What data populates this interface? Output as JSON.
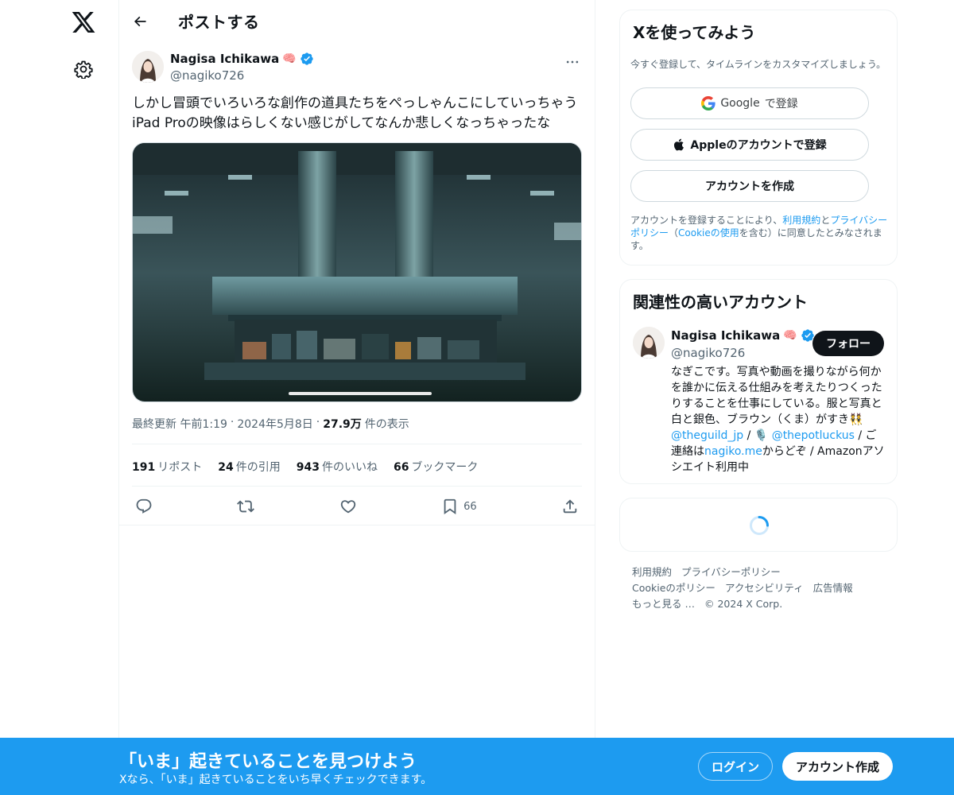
{
  "nav": {
    "logo_icon": "x-logo-icon",
    "settings_icon": "gear-icon"
  },
  "header": {
    "title": "ポストする",
    "back_icon": "arrow-left-icon"
  },
  "post": {
    "author_name": "Nagisa Ichikawa",
    "author_emoji": "🧠",
    "verified": true,
    "handle": "@nagiko726",
    "text": "しかし冒頭でいろいろな創作の道具たちをぺっしゃんこにしていっちゃう\niPad Proの映像はらしくない感じがしてなんか悲しくなっちゃったな",
    "meta_prefix": "最終更新 午前1:19",
    "meta_date": "2024年5月8日",
    "views_value": "27.9万",
    "views_label": "件の表示",
    "stats": {
      "reposts_value": "191",
      "reposts_label": "リポスト",
      "quotes_value": "24",
      "quotes_label": "件の引用",
      "likes_value": "943",
      "likes_label": "件のいいね",
      "bookmarks_value": "66",
      "bookmarks_label": "ブックマーク"
    },
    "bookmark_count": "66"
  },
  "signup_card": {
    "title": "Xを使ってみよう",
    "subtitle": "今すぐ登録して、タイムラインをカスタマイズしましょう。",
    "google_brand": "Google",
    "google_label": "で登録",
    "apple_label": "Appleのアカウントで登録",
    "create_label": "アカウントを作成",
    "terms_1": "アカウントを登録することにより、",
    "terms_link1": "利用規約",
    "terms_2": "と",
    "terms_link2": "プライバシーポリシー",
    "terms_3": "（",
    "terms_link3": "Cookieの使用",
    "terms_4": "を含む）に同意したとみなされます。"
  },
  "related": {
    "title": "関連性の高いアカウント",
    "name": "Nagisa Ichikawa",
    "emoji": "🧠",
    "handle": "@nagiko726",
    "follow_label": "フォロー",
    "bio_1": "なぎこです。写真や動画を撮りながら何かを誰かに伝える仕組みを考えたりつくったりすることを仕事にしている。服と写真と白と銀色、ブラウン（くま）がすき👯",
    "bio_link1": "@theguild_jp",
    "bio_2": " / 🎙️ ",
    "bio_link2": "@thepotluckus",
    "bio_3": " / ご連絡は",
    "bio_link3": "nagiko.me",
    "bio_4": "からどぞ / Amazonアソシエイト利用中"
  },
  "footer": {
    "links": [
      "利用規約",
      "プライバシーポリシー",
      "Cookieのポリシー",
      "アクセシビリティ",
      "広告情報",
      "もっと見る …",
      "© 2024 X Corp."
    ]
  },
  "banner": {
    "title": "「いま」起きていることを見つけよう",
    "subtitle": "Xなら、「いま」起きていることをいち早くチェックできます。",
    "login_label": "ログイン",
    "signup_label": "アカウント作成"
  },
  "colors": {
    "accent": "#1d9bf0",
    "text": "#0f1419",
    "muted": "#536471"
  }
}
